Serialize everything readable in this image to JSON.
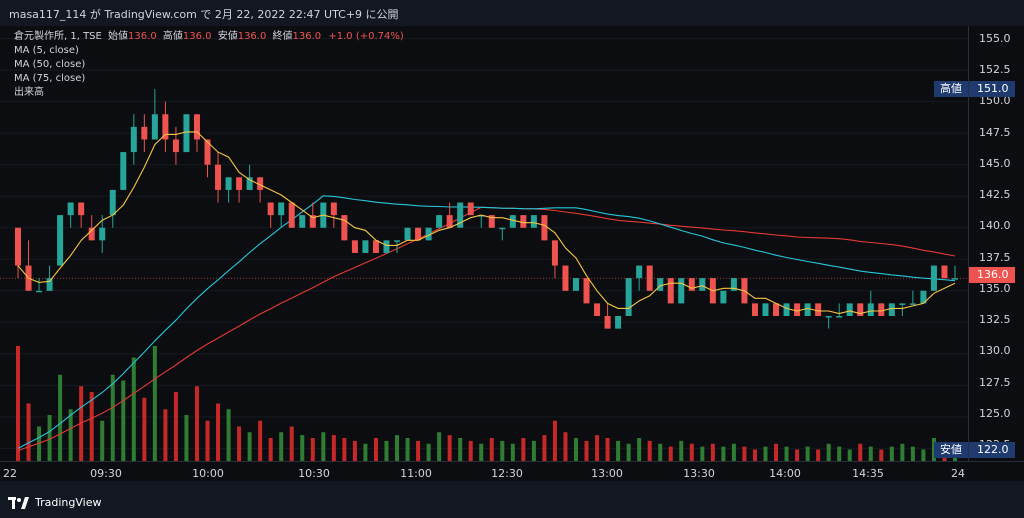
{
  "header": {
    "caption": "masa117_114 が TradingView.com で 2月 22, 2022 22:47 UTC+9 に公開"
  },
  "legend": {
    "symbol": "倉元製作所, 1, TSE",
    "open_label": "始値",
    "open": "136.0",
    "high_label": "高値",
    "high": "136.0",
    "low_label": "安値",
    "low": "136.0",
    "close_label": "終値",
    "close": "136.0",
    "change": "+1.0 (+0.74%)",
    "ma5": "MA (5, close)",
    "ma50": "MA (50, close)",
    "ma75": "MA (75, close)",
    "volume": "出来高"
  },
  "yaxis": {
    "ticks": [
      "155.0",
      "152.5",
      "150.0",
      "147.5",
      "145.0",
      "142.5",
      "140.0",
      "137.5",
      "135.0",
      "132.5",
      "130.0",
      "127.5",
      "125.0",
      "122.5"
    ],
    "high_tag": "高値",
    "high_value": "151.0",
    "current_value": "136.0",
    "low_tag": "安値",
    "low_value": "122.0"
  },
  "xaxis": {
    "ticks": [
      "22",
      "09:30",
      "10:00",
      "10:30",
      "11:00",
      "12:30",
      "13:00",
      "13:30",
      "14:00",
      "14:35",
      "24"
    ]
  },
  "footer": {
    "brand": "TradingView"
  },
  "colors": {
    "up": "#26a69a",
    "down": "#ef5350",
    "ma5": "#f5c542",
    "ma50": "#26c6da",
    "ma75": "#e53935",
    "vol_up": "#2e7d32",
    "vol_down": "#c62828"
  },
  "chart_data": {
    "type": "candlestick",
    "title": "倉元製作所, 1, TSE",
    "ylim": [
      121.5,
      156
    ],
    "candles": [
      {
        "o": 140,
        "h": 140,
        "l": 136,
        "c": 137
      },
      {
        "o": 137,
        "h": 139,
        "l": 135,
        "c": 135
      },
      {
        "o": 135,
        "h": 136,
        "l": 135,
        "c": 135
      },
      {
        "o": 135,
        "h": 137,
        "l": 135,
        "c": 136
      },
      {
        "o": 137,
        "h": 141,
        "l": 137,
        "c": 141
      },
      {
        "o": 141,
        "h": 142,
        "l": 140,
        "c": 142
      },
      {
        "o": 142,
        "h": 142,
        "l": 140,
        "c": 141
      },
      {
        "o": 140,
        "h": 141,
        "l": 139,
        "c": 139
      },
      {
        "o": 139,
        "h": 141,
        "l": 138,
        "c": 140
      },
      {
        "o": 141,
        "h": 143,
        "l": 140,
        "c": 143
      },
      {
        "o": 143,
        "h": 146,
        "l": 143,
        "c": 146
      },
      {
        "o": 146,
        "h": 149,
        "l": 145,
        "c": 148
      },
      {
        "o": 148,
        "h": 149,
        "l": 146,
        "c": 147
      },
      {
        "o": 147,
        "h": 151,
        "l": 147,
        "c": 149
      },
      {
        "o": 149,
        "h": 150,
        "l": 146,
        "c": 147
      },
      {
        "o": 147,
        "h": 148,
        "l": 145,
        "c": 146
      },
      {
        "o": 146,
        "h": 149,
        "l": 146,
        "c": 149
      },
      {
        "o": 149,
        "h": 149,
        "l": 146,
        "c": 147
      },
      {
        "o": 147,
        "h": 147,
        "l": 144,
        "c": 145
      },
      {
        "o": 145,
        "h": 146,
        "l": 142,
        "c": 143
      },
      {
        "o": 143,
        "h": 144,
        "l": 142,
        "c": 144
      },
      {
        "o": 144,
        "h": 144,
        "l": 142,
        "c": 143
      },
      {
        "o": 143,
        "h": 145,
        "l": 143,
        "c": 144
      },
      {
        "o": 144,
        "h": 144,
        "l": 142,
        "c": 143
      },
      {
        "o": 142,
        "h": 142,
        "l": 140,
        "c": 141
      },
      {
        "o": 141,
        "h": 142,
        "l": 140,
        "c": 142
      },
      {
        "o": 142,
        "h": 142,
        "l": 140,
        "c": 140
      },
      {
        "o": 140,
        "h": 141,
        "l": 140,
        "c": 141
      },
      {
        "o": 141,
        "h": 142,
        "l": 140,
        "c": 140
      },
      {
        "o": 140,
        "h": 142,
        "l": 140,
        "c": 142
      },
      {
        "o": 142,
        "h": 142,
        "l": 140,
        "c": 141
      },
      {
        "o": 141,
        "h": 141,
        "l": 139,
        "c": 139
      },
      {
        "o": 139,
        "h": 139,
        "l": 138,
        "c": 138
      },
      {
        "o": 138,
        "h": 139,
        "l": 138,
        "c": 139
      },
      {
        "o": 139,
        "h": 139,
        "l": 138,
        "c": 138
      },
      {
        "o": 138,
        "h": 139,
        "l": 138,
        "c": 139
      },
      {
        "o": 139,
        "h": 139,
        "l": 138,
        "c": 139
      },
      {
        "o": 139,
        "h": 140,
        "l": 139,
        "c": 140
      },
      {
        "o": 140,
        "h": 140,
        "l": 139,
        "c": 139
      },
      {
        "o": 139,
        "h": 140,
        "l": 139,
        "c": 140
      },
      {
        "o": 140,
        "h": 141,
        "l": 140,
        "c": 141
      },
      {
        "o": 141,
        "h": 142,
        "l": 140,
        "c": 140
      },
      {
        "o": 140,
        "h": 142,
        "l": 140,
        "c": 142
      },
      {
        "o": 142,
        "h": 142,
        "l": 141,
        "c": 141
      },
      {
        "o": 141,
        "h": 141,
        "l": 140,
        "c": 141
      },
      {
        "o": 141,
        "h": 141,
        "l": 140,
        "c": 140
      },
      {
        "o": 140,
        "h": 140,
        "l": 139,
        "c": 140
      },
      {
        "o": 140,
        "h": 141,
        "l": 140,
        "c": 141
      },
      {
        "o": 141,
        "h": 141,
        "l": 140,
        "c": 140
      },
      {
        "o": 140,
        "h": 141,
        "l": 140,
        "c": 141
      },
      {
        "o": 141,
        "h": 141,
        "l": 139,
        "c": 139
      },
      {
        "o": 139,
        "h": 139,
        "l": 136,
        "c": 137
      },
      {
        "o": 137,
        "h": 137,
        "l": 135,
        "c": 135
      },
      {
        "o": 135,
        "h": 136,
        "l": 135,
        "c": 136
      },
      {
        "o": 136,
        "h": 136,
        "l": 134,
        "c": 134
      },
      {
        "o": 134,
        "h": 134,
        "l": 133,
        "c": 133
      },
      {
        "o": 133,
        "h": 134,
        "l": 132,
        "c": 132
      },
      {
        "o": 132,
        "h": 133,
        "l": 132,
        "c": 133
      },
      {
        "o": 133,
        "h": 136,
        "l": 133,
        "c": 136
      },
      {
        "o": 136,
        "h": 137,
        "l": 135,
        "c": 137
      },
      {
        "o": 137,
        "h": 137,
        "l": 135,
        "c": 135
      },
      {
        "o": 135,
        "h": 136,
        "l": 135,
        "c": 136
      },
      {
        "o": 136,
        "h": 136,
        "l": 134,
        "c": 134
      },
      {
        "o": 134,
        "h": 136,
        "l": 134,
        "c": 136
      },
      {
        "o": 136,
        "h": 136,
        "l": 135,
        "c": 135
      },
      {
        "o": 135,
        "h": 136,
        "l": 135,
        "c": 136
      },
      {
        "o": 136,
        "h": 136,
        "l": 134,
        "c": 134
      },
      {
        "o": 134,
        "h": 135,
        "l": 134,
        "c": 135
      },
      {
        "o": 135,
        "h": 136,
        "l": 135,
        "c": 136
      },
      {
        "o": 136,
        "h": 136,
        "l": 134,
        "c": 134
      },
      {
        "o": 134,
        "h": 134,
        "l": 133,
        "c": 133
      },
      {
        "o": 133,
        "h": 134,
        "l": 133,
        "c": 134
      },
      {
        "o": 134,
        "h": 134,
        "l": 133,
        "c": 133
      },
      {
        "o": 133,
        "h": 134,
        "l": 133,
        "c": 134
      },
      {
        "o": 134,
        "h": 134,
        "l": 133,
        "c": 133
      },
      {
        "o": 133,
        "h": 134,
        "l": 133,
        "c": 134
      },
      {
        "o": 134,
        "h": 134,
        "l": 133,
        "c": 133
      },
      {
        "o": 133,
        "h": 133,
        "l": 132,
        "c": 133
      },
      {
        "o": 133,
        "h": 134,
        "l": 133,
        "c": 133
      },
      {
        "o": 133,
        "h": 134,
        "l": 133,
        "c": 134
      },
      {
        "o": 134,
        "h": 134,
        "l": 133,
        "c": 133
      },
      {
        "o": 133,
        "h": 135,
        "l": 133,
        "c": 134
      },
      {
        "o": 134,
        "h": 134,
        "l": 133,
        "c": 133
      },
      {
        "o": 133,
        "h": 134,
        "l": 133,
        "c": 134
      },
      {
        "o": 134,
        "h": 134,
        "l": 133,
        "c": 134
      },
      {
        "o": 134,
        "h": 135,
        "l": 134,
        "c": 134
      },
      {
        "o": 134,
        "h": 135,
        "l": 134,
        "c": 135
      },
      {
        "o": 135,
        "h": 137,
        "l": 135,
        "c": 137
      },
      {
        "o": 137,
        "h": 137,
        "l": 136,
        "c": 136
      },
      {
        "o": 136,
        "h": 137,
        "l": 136,
        "c": 136
      }
    ],
    "volume": [
      40,
      20,
      12,
      16,
      30,
      18,
      26,
      24,
      14,
      30,
      28,
      36,
      22,
      40,
      18,
      24,
      16,
      26,
      14,
      20,
      18,
      12,
      10,
      14,
      8,
      10,
      12,
      9,
      8,
      10,
      9,
      8,
      7,
      6,
      8,
      7,
      9,
      8,
      7,
      6,
      10,
      9,
      8,
      7,
      6,
      8,
      7,
      6,
      8,
      7,
      9,
      14,
      10,
      8,
      7,
      9,
      8,
      7,
      6,
      8,
      7,
      6,
      5,
      7,
      6,
      5,
      6,
      5,
      6,
      5,
      4,
      5,
      6,
      5,
      4,
      5,
      4,
      6,
      5,
      4,
      6,
      5,
      4,
      5,
      6,
      5,
      4,
      8,
      6,
      5
    ]
  }
}
